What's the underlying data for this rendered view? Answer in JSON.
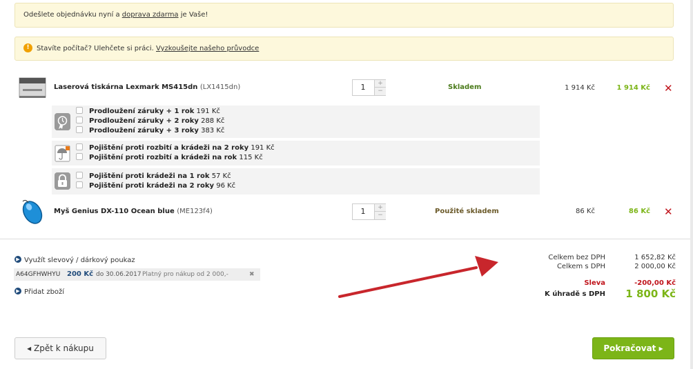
{
  "notices": {
    "shipping_prefix": "Odešlete objednávku nyní a ",
    "shipping_link": "doprava zdarma",
    "shipping_suffix": " je Vaše!",
    "guide_text": "Stavíte počítač? Ulehčete si práci. ",
    "guide_link": "Vyzkoušejte našeho průvodce"
  },
  "products": [
    {
      "name": "Laserová tiskárna Lexmark MS415dn",
      "code": "(LX1415dn)",
      "qty": "1",
      "stock": "Skladem",
      "unit_price": "1 914 Kč",
      "total_price": "1 914 Kč"
    },
    {
      "name": "Myš Genius DX-110 Ocean blue",
      "code": "(ME123f4)",
      "qty": "1",
      "stock": "Použité skladem",
      "unit_price": "86 Kč",
      "total_price": "86 Kč"
    }
  ],
  "services": {
    "warranty": [
      {
        "label": "Prodloužení záruky + 1 rok",
        "price": "191 Kč"
      },
      {
        "label": "Prodloužení záruky + 2 roky",
        "price": "288 Kč"
      },
      {
        "label": "Prodloužení záruky + 3 roky",
        "price": "383 Kč"
      }
    ],
    "insurance": [
      {
        "label": "Pojištění proti rozbití a krádeži na 2 roky",
        "price": "191 Kč"
      },
      {
        "label": "Pojištění proti rozbití a krádeži na rok",
        "price": "115 Kč"
      }
    ],
    "theft": [
      {
        "label": "Pojištění proti krádeži na 1 rok",
        "price": "57 Kč"
      },
      {
        "label": "Pojištění proti krádeži na 2 roky",
        "price": "96 Kč"
      }
    ]
  },
  "voucher": {
    "link": "Využít slevový / dárkový poukaz",
    "code": "A64GFHWHYU",
    "value": "200 Kč",
    "valid_until": "do 30.06.2017",
    "note": "Platný pro nákup od 2 000,-",
    "remove": "✖"
  },
  "add_item": "Přidat zboží",
  "summary": {
    "without_vat_label": "Celkem bez DPH",
    "without_vat": "1 652,82 Kč",
    "with_vat_label": "Celkem s DPH",
    "with_vat": "2 000,00 Kč",
    "discount_label": "Sleva",
    "discount": "-200,00 Kč",
    "pay_label": "K úhradě s DPH",
    "pay": "1 800 Kč"
  },
  "buttons": {
    "back": "Zpět k nákupu",
    "continue": "Pokračovat"
  },
  "colors": {
    "accent_green": "#7cb518",
    "remove_red": "#c0141b",
    "notice_bg": "#fdf8dc"
  }
}
